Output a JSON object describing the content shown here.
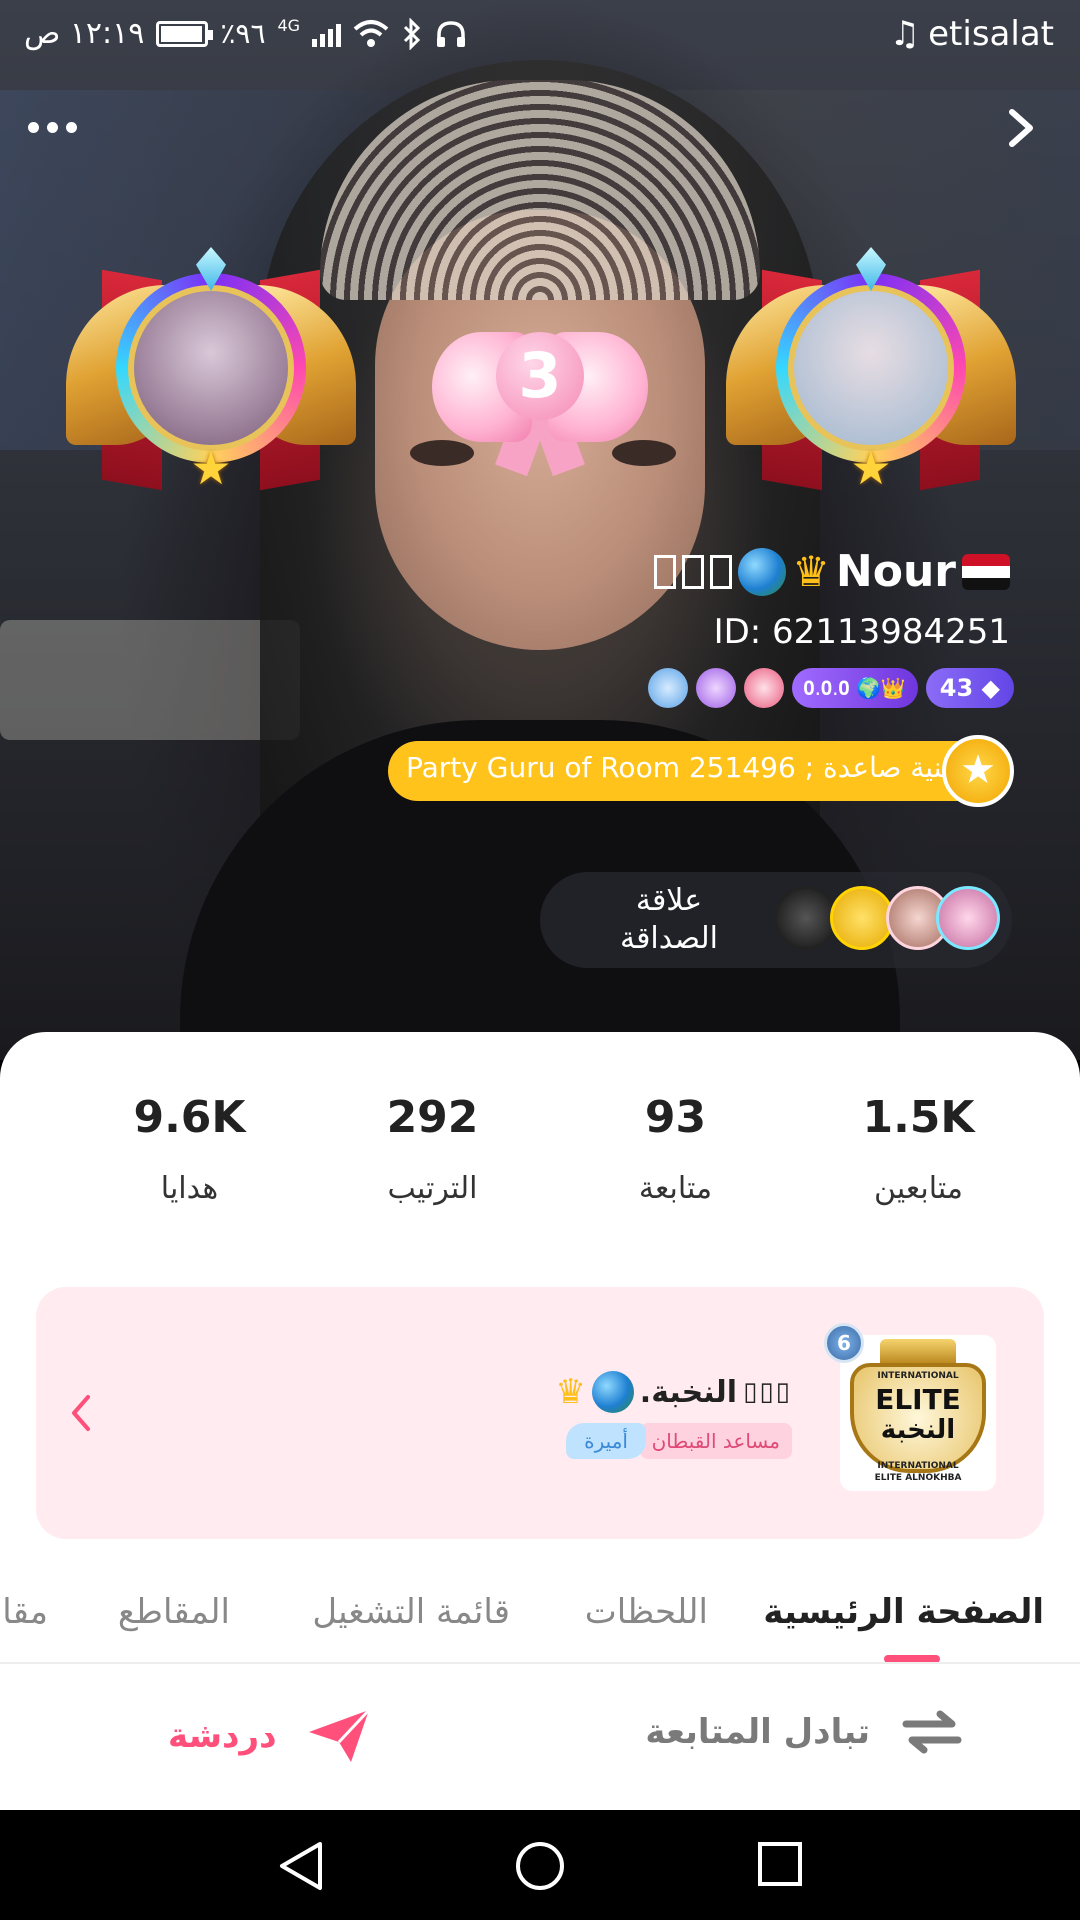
{
  "status_bar": {
    "time": "١٢:١٩ ص",
    "battery": "٪٩٦",
    "battery_level": 0.96,
    "network": "4G",
    "carrier": "etisalat"
  },
  "profile": {
    "name": "Nour",
    "id_text": "ID: 62113984251",
    "level": "43",
    "family_tag": "𝟎.𝟎.𝟎",
    "room_title": "Party Guru of Room 251496 ; مغنية صاعدة",
    "bow_number": "3",
    "friends_label": "علاقة الصداقة"
  },
  "stats": [
    {
      "value": "1.5K",
      "label": "متابعين"
    },
    {
      "value": "93",
      "label": "متابعة"
    },
    {
      "value": "292",
      "label": "الترتيب"
    },
    {
      "value": "9.6K",
      "label": "هدايا"
    }
  ],
  "group": {
    "name": ".النخبة",
    "level": "6",
    "role": "مساعد القبطان",
    "title": "أميرة",
    "logo_top": "INTERNATIONAL",
    "logo_main": "ELITE",
    "logo_ar": "النخبة",
    "logo_bottom1": "INTERNATIONAL",
    "logo_bottom2": "ELITE ALNOKHBA"
  },
  "tabs": [
    "الصفحة الرئيسية",
    "اللحظات",
    "قائمة التشغيل",
    "المقاطع",
    "مقا"
  ],
  "actions": {
    "follow_exchange": "تبادل المتابعة",
    "chat": "دردشة"
  },
  "colors": {
    "accent": "#ff4f7b",
    "gold": "#ffc31c",
    "group_bg": "#ffebf0"
  }
}
